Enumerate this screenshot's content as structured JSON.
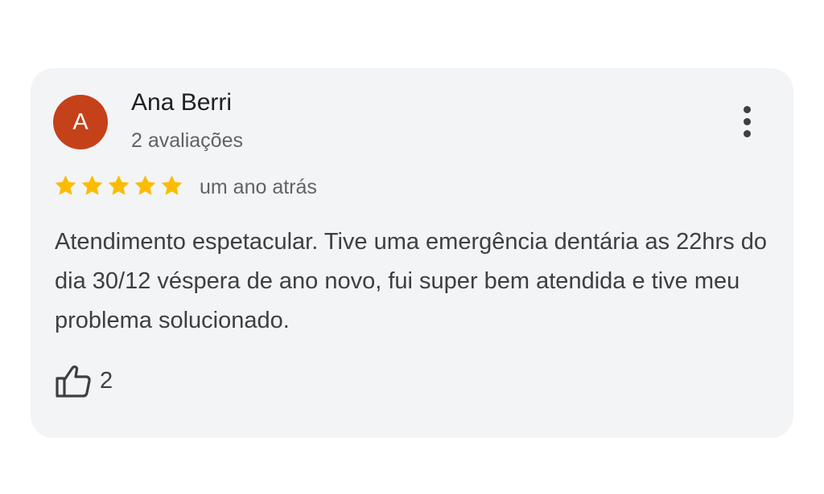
{
  "review": {
    "avatar_letter": "A",
    "avatar_color": "#c5411a",
    "reviewer_name": "Ana Berri",
    "reviewer_meta": "2 avaliações",
    "rating": 5,
    "rating_max": 5,
    "star_color": "#fbbc04",
    "time": "um ano atrás",
    "text": "Atendimento espetacular. Tive uma emergência dentária as 22hrs do dia 30/12 véspera de ano novo, fui super bem atendida e tive meu problema solucionado.",
    "like_count": "2",
    "like_icon": "thumbs-up-icon",
    "more_icon": "more-vert-icon"
  }
}
